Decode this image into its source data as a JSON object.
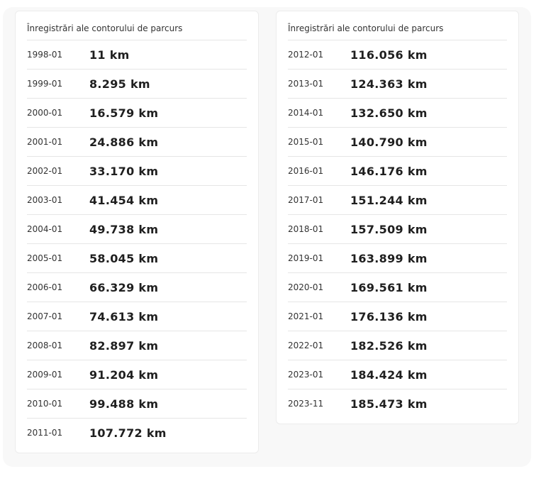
{
  "panels": [
    {
      "title": "Înregistrări ale contorului de parcurs",
      "records": [
        {
          "date": "1998-01",
          "value": "11 km"
        },
        {
          "date": "1999-01",
          "value": "8.295 km"
        },
        {
          "date": "2000-01",
          "value": "16.579 km"
        },
        {
          "date": "2001-01",
          "value": "24.886 km"
        },
        {
          "date": "2002-01",
          "value": "33.170 km"
        },
        {
          "date": "2003-01",
          "value": "41.454 km"
        },
        {
          "date": "2004-01",
          "value": "49.738 km"
        },
        {
          "date": "2005-01",
          "value": "58.045 km"
        },
        {
          "date": "2006-01",
          "value": "66.329 km"
        },
        {
          "date": "2007-01",
          "value": "74.613 km"
        },
        {
          "date": "2008-01",
          "value": "82.897 km"
        },
        {
          "date": "2009-01",
          "value": "91.204 km"
        },
        {
          "date": "2010-01",
          "value": "99.488 km"
        },
        {
          "date": "2011-01",
          "value": "107.772 km"
        }
      ]
    },
    {
      "title": "Înregistrări ale contorului de parcurs",
      "records": [
        {
          "date": "2012-01",
          "value": "116.056 km"
        },
        {
          "date": "2013-01",
          "value": "124.363 km"
        },
        {
          "date": "2014-01",
          "value": "132.650 km"
        },
        {
          "date": "2015-01",
          "value": "140.790 km"
        },
        {
          "date": "2016-01",
          "value": "146.176 km"
        },
        {
          "date": "2017-01",
          "value": "151.244 km"
        },
        {
          "date": "2018-01",
          "value": "157.509 km"
        },
        {
          "date": "2019-01",
          "value": "163.899 km"
        },
        {
          "date": "2020-01",
          "value": "169.561 km"
        },
        {
          "date": "2021-01",
          "value": "176.136 km"
        },
        {
          "date": "2022-01",
          "value": "182.526 km"
        },
        {
          "date": "2023-01",
          "value": "184.424 km"
        },
        {
          "date": "2023-11",
          "value": "185.473 km"
        }
      ]
    }
  ]
}
